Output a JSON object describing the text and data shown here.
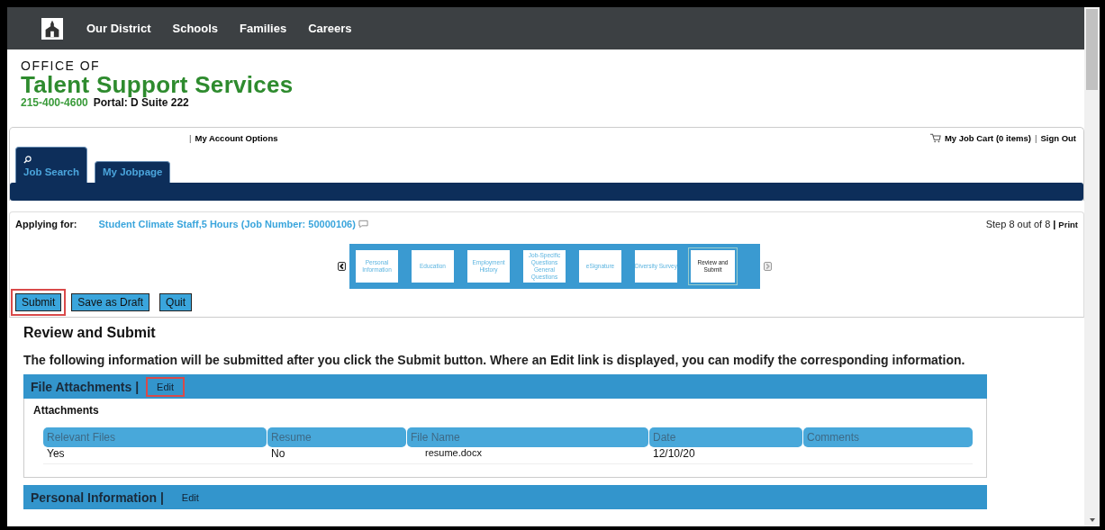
{
  "nav": {
    "items": [
      "Our District",
      "Schools",
      "Families",
      "Careers"
    ]
  },
  "header": {
    "overline": "OFFICE OF",
    "title": "Talent Support Services",
    "phone": "215-400-4600",
    "portal": "Portal: D Suite 222"
  },
  "account_bar": {
    "separator_left": "|",
    "options": "My Account Options",
    "cart": "My Job Cart (0 items)",
    "separator_right": "|",
    "sign_out": "Sign Out"
  },
  "tabs": [
    {
      "label": "Job Search",
      "icon": true
    },
    {
      "label": "My Jobpage",
      "icon": false
    }
  ],
  "application": {
    "label": "Applying for:",
    "job": "Student Climate Staff,5 Hours (Job Number: 50000106)",
    "step": "Step 8 out of 8",
    "separator": "|",
    "print": "Print"
  },
  "steps": [
    {
      "label": "Personal Information",
      "selected": false
    },
    {
      "label": "Education",
      "selected": false
    },
    {
      "label": "Employment History",
      "selected": false
    },
    {
      "label": "Job-Specific Questions General Questions",
      "selected": false
    },
    {
      "label": "eSignature",
      "selected": false
    },
    {
      "label": "Diversity Survey",
      "selected": false
    },
    {
      "label": "Review and Submit",
      "selected": true
    }
  ],
  "buttons": [
    {
      "label": "Submit",
      "highlighted": true
    },
    {
      "label": "Save as Draft",
      "highlighted": false
    },
    {
      "label": "Quit",
      "highlighted": false
    }
  ],
  "review": {
    "title": "Review and Submit",
    "intro": "The following information will be submitted after you click the Submit button. Where an Edit link is displayed, you can modify the corresponding information."
  },
  "sections": [
    {
      "title": "File Attachments |",
      "edit": "Edit",
      "edit_highlighted": true,
      "subtitle": "Attachments",
      "table": {
        "columns": [
          "Relevant Files",
          "Resume",
          "File Name",
          "Date",
          "Comments"
        ],
        "rows": [
          [
            "Yes",
            "No",
            "resume.docx",
            "12/10/20",
            ""
          ]
        ]
      }
    },
    {
      "title": "Personal Information |",
      "edit": "Edit",
      "edit_highlighted": false
    }
  ]
}
